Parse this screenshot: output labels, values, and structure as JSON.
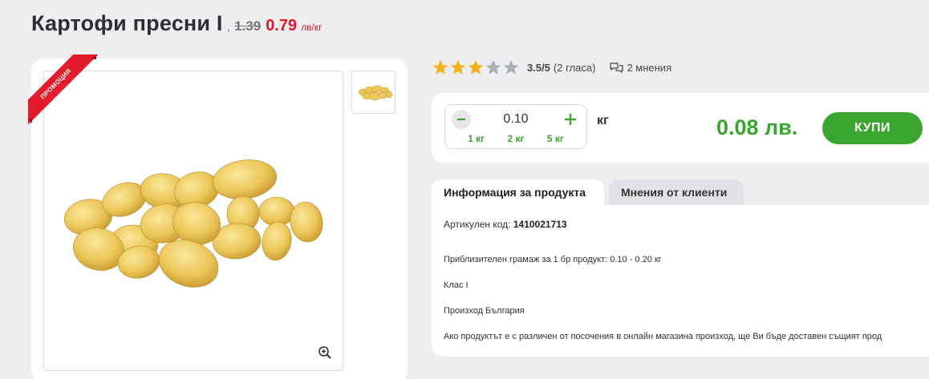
{
  "product": {
    "title": "Картофи пресни I",
    "comma": ",",
    "old_price": "1.39",
    "new_price": "0.79",
    "price_unit": "лв/кг"
  },
  "badge": {
    "label": "ПРОМОЦИЯ"
  },
  "rating": {
    "stars_filled": 3,
    "stars_total": 5,
    "value": "3.5/5",
    "votes": "(2 гласа)",
    "opinions": "2 мнения"
  },
  "purchase": {
    "quantity": "0.10",
    "presets": [
      "1 кг",
      "2 кг",
      "5 кг"
    ],
    "unit": "кг",
    "total": "0.08 лв.",
    "buy_label": "КУПИ"
  },
  "tabs": [
    {
      "label": "Информация за продукта",
      "active": true
    },
    {
      "label": "Мнения от клиенти",
      "active": false
    }
  ],
  "info": {
    "code_label": "Артикулен код:",
    "code_value": "1410021713",
    "weight": "Приблизителен грамаж за 1 бр продукт: 0.10 - 0.20 кг",
    "class": "Клас I",
    "origin": "Произход България",
    "note": "Ако продуктът е с различен от посочения в онлайн магазина произход, ще Ви бъде доставен същият прод"
  },
  "colors": {
    "accent_green": "#3aa62f",
    "sale_red": "#e0162b",
    "star_gold": "#f3b21b",
    "star_grey": "#a9afb6"
  },
  "icons": [
    "zoom-in-icon",
    "minus-icon",
    "plus-icon",
    "chat-bubbles-icon",
    "star-icon"
  ]
}
